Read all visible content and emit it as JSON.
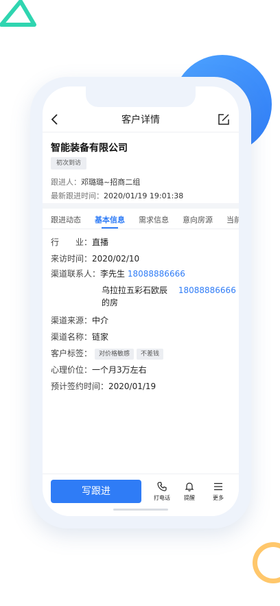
{
  "nav": {
    "title": "客户详情"
  },
  "customer": {
    "name": "智能装备有限公司",
    "visit_tag": "初次到访",
    "follower_label": "跟进人：",
    "follower_value": "邓璐璐~招商二组",
    "latest_label": "最新跟进时间：",
    "latest_value": "2020/01/19  19:01:38"
  },
  "tabs": [
    {
      "label": "跟进动态"
    },
    {
      "label": "基本信息",
      "active": true
    },
    {
      "label": "需求信息"
    },
    {
      "label": "意向房源"
    },
    {
      "label": "当前"
    }
  ],
  "details": {
    "industry_label": "行　　业：",
    "industry_value": "直播",
    "visit_time_label": "来访时间：",
    "visit_time_value": "2020/02/10",
    "channel_contact_label": "渠道联系人：",
    "contact1_name": "李先生",
    "contact1_phone": "18088886666",
    "contact2_name_line1": "乌拉拉五彩石欧辰",
    "contact2_name_line2": "的房",
    "contact2_phone": "18088886666",
    "channel_source_label": "渠道来源：",
    "channel_source_value": "中介",
    "channel_name_label": "渠道名称：",
    "channel_name_value": "链家",
    "customer_tags_label": "客户标签：",
    "customer_tags": [
      "对价格敏感",
      "不差钱"
    ],
    "psych_price_label": "心理价位：",
    "psych_price_value": "一个月3万左右",
    "expected_sign_label": "预计签约时间：",
    "expected_sign_value": "2020/01/19"
  },
  "bottom": {
    "write_label": "写跟进",
    "call_label": "打电话",
    "remind_label": "提醒",
    "more_label": "更多"
  },
  "colors": {
    "accent": "#2f7cf6",
    "ring": "#ffc76b",
    "triangle": "#2fd5b0"
  }
}
